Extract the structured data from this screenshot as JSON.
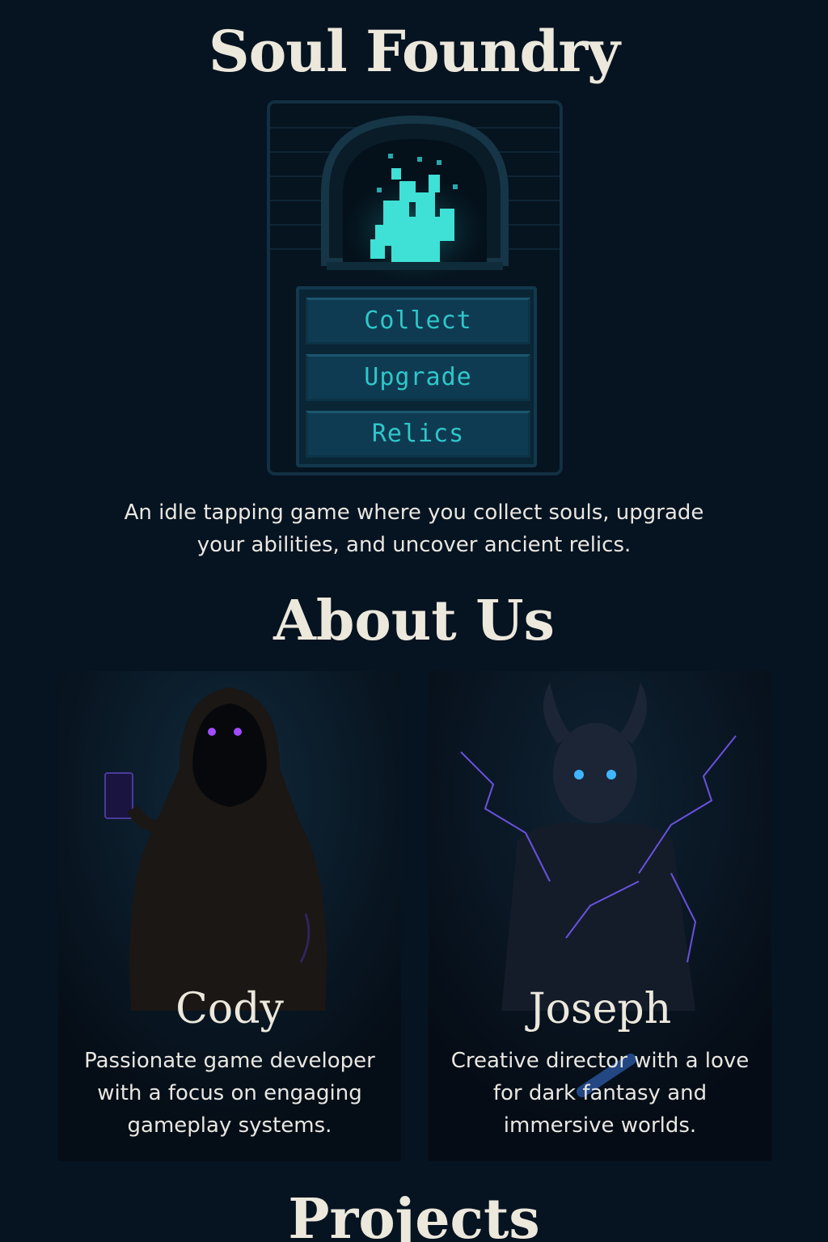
{
  "header": {
    "title": "Soul Foundry"
  },
  "game": {
    "menu": [
      {
        "label": "Collect"
      },
      {
        "label": "Upgrade"
      },
      {
        "label": "Relics"
      }
    ],
    "flame_color": "#3fe0d6"
  },
  "intro": {
    "line1": "An idle tapping game where you collect souls, upgrade",
    "line2": "your abilities, and uncover ancient relics."
  },
  "about": {
    "title": "About Us",
    "members": [
      {
        "name": "Cody",
        "desc_lines": [
          "Passionate game developer",
          "with a focus on engaging",
          "gameplay systems."
        ],
        "icon": "hooded-figure-portrait",
        "eye_color": "#a24bff"
      },
      {
        "name": "Joseph",
        "desc_lines": [
          "Creative director with a love",
          "for dark fantasy and",
          "immersive worlds."
        ],
        "icon": "horned-demon-portrait",
        "eye_color": "#3fb6ff"
      }
    ]
  },
  "projects": {
    "title": "Projects"
  },
  "colors": {
    "background": "#061320",
    "heading": "#ece8dc",
    "accent": "#2fc7c9"
  }
}
